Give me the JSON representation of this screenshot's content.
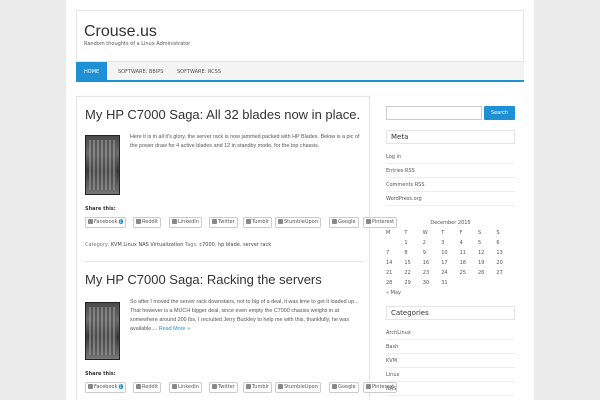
{
  "site": {
    "title": "Crouse.us",
    "description": "Random thoughts of a Linux Administrator"
  },
  "nav": {
    "items": [
      {
        "label": "HOME",
        "active": true
      },
      {
        "label": "SOFTWARE: BBIPS",
        "active": false
      },
      {
        "label": "SOFTWARE: RCSS",
        "active": false
      }
    ]
  },
  "posts": [
    {
      "title": "My HP C7000 Saga: All 32 blades now in place.",
      "excerpt": "Here it is in all it's glory, the server rack is now jammed packed with HP Blades. Below is a pic of the power draw for 4 active blades and 12 in standby mode, for the top chassis.",
      "read_more": "",
      "share_label": "Share this:",
      "share_buttons": [
        {
          "label": "Facebook",
          "count": "1"
        },
        {
          "label": "Reddit"
        },
        {
          "label": "LinkedIn"
        },
        {
          "label": "Twitter"
        },
        {
          "label": "Tumblr"
        },
        {
          "label": "StumbleUpon"
        },
        {
          "label": "Google"
        },
        {
          "label": "Pinterest"
        }
      ],
      "category_label": "Category:",
      "categories": [
        "KVM",
        "Linux",
        "NAS",
        "Virtualization"
      ],
      "tags_label": "Tags:",
      "tags": [
        "c7000",
        "hp blade",
        "server rack"
      ]
    },
    {
      "title": "My HP C7000 Saga: Racking the servers",
      "excerpt": "So after I moved the server rack downstairs, not to big of a deal, it was time to get it loaded up... That however is a MUCH bigger deal, since even empty the C7000 chassis weighs in at somewhere around 200 lbs, I recruited Jerry Buckley to help me with this, thankfully, he was available.... ",
      "read_more": "Read More »",
      "share_label": "Share this:",
      "share_buttons": [
        {
          "label": "Facebook",
          "count": "1"
        },
        {
          "label": "Reddit"
        },
        {
          "label": "LinkedIn"
        },
        {
          "label": "Twitter"
        },
        {
          "label": "Tumblr"
        },
        {
          "label": "StumbleUpon"
        },
        {
          "label": "Google"
        },
        {
          "label": "Pinterest"
        }
      ]
    }
  ],
  "sidebar": {
    "search_placeholder": "",
    "search_button": "Search",
    "meta_title": "Meta",
    "meta_links": [
      "Log in",
      "Entries RSS",
      "Comments RSS",
      "WordPress.org"
    ],
    "calendar": {
      "caption": "December 2015",
      "weekdays": [
        "M",
        "T",
        "W",
        "T",
        "F",
        "S",
        "S"
      ],
      "weeks": [
        [
          "",
          "1",
          "2",
          "3",
          "4",
          "5",
          "6"
        ],
        [
          "7",
          "8",
          "9",
          "10",
          "11",
          "12",
          "13"
        ],
        [
          "14",
          "15",
          "16",
          "17",
          "18",
          "19",
          "20"
        ],
        [
          "21",
          "22",
          "23",
          "24",
          "25",
          "26",
          "27"
        ],
        [
          "28",
          "29",
          "30",
          "31",
          "",
          "",
          ""
        ]
      ],
      "prev": "« May"
    },
    "categories_title": "Categories",
    "category_links": [
      "ArchLinux",
      "Bash",
      "KVM",
      "Linux",
      "NAS"
    ]
  },
  "colors": {
    "accent": "#1e90d6",
    "background": "#eaeaea"
  }
}
